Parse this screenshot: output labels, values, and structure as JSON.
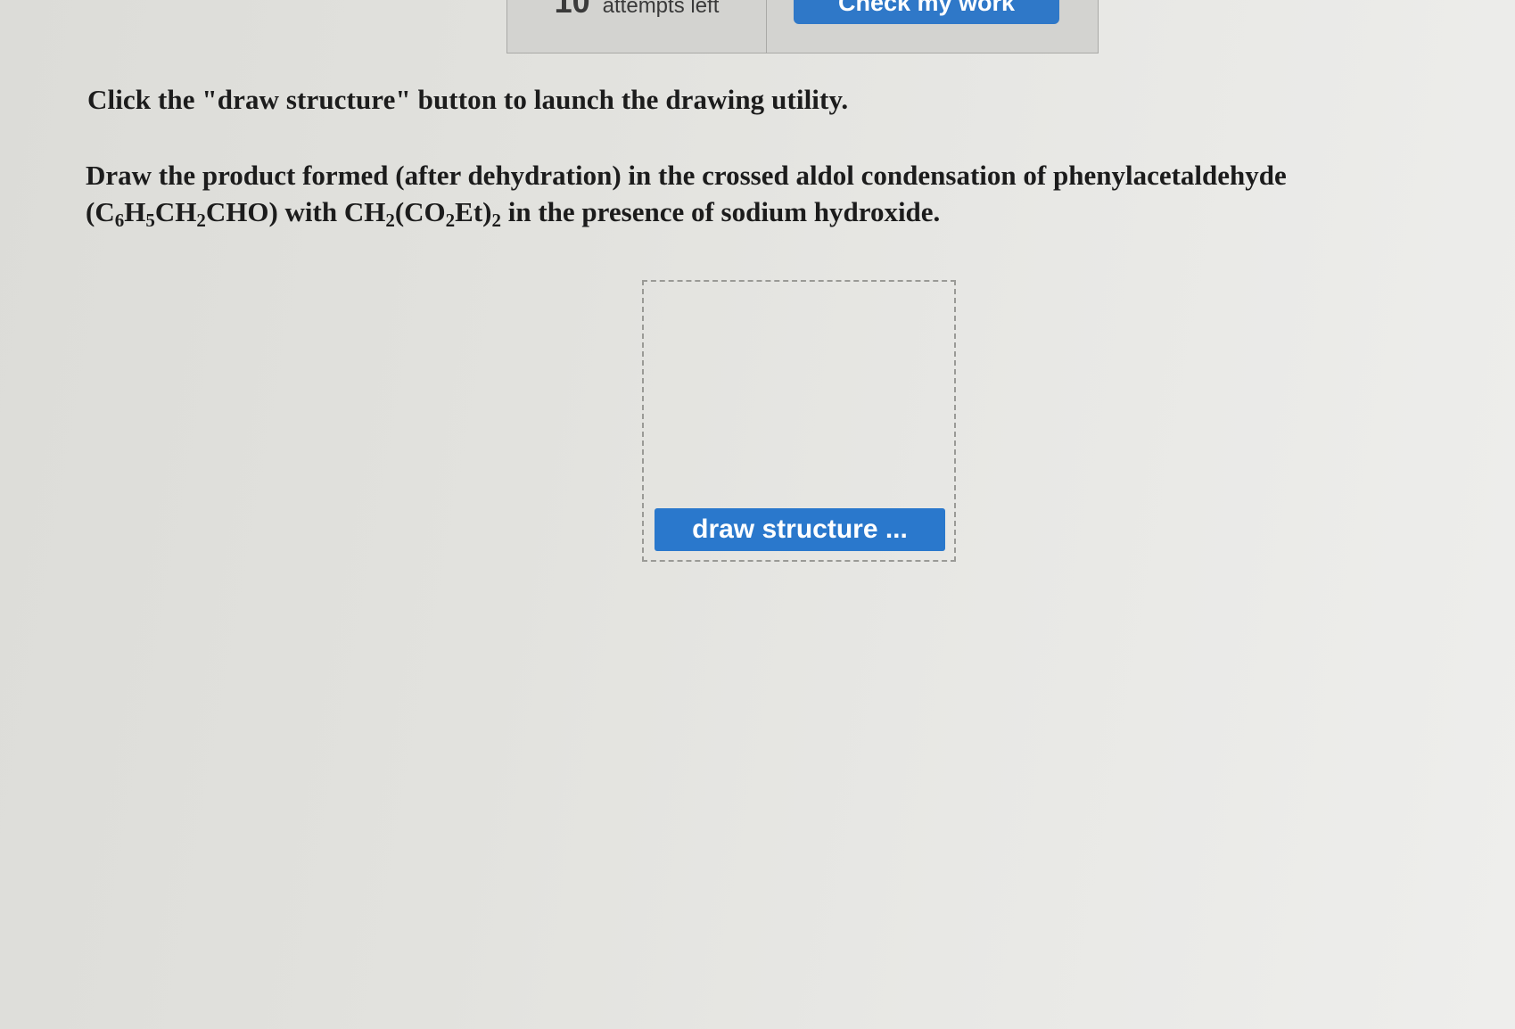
{
  "header": {
    "attempts_count": "10",
    "attempts_label": "attempts left",
    "check_button_label": "Check my work"
  },
  "instruction": "Click the \"draw structure\" button to launch the drawing utility.",
  "question": {
    "line1": "Draw the product formed (after dehydration) in the crossed aldol condensation of phenylacetaldehyde",
    "line2": {
      "p1": "(C",
      "s1": "6",
      "p2": "H",
      "s2": "5",
      "p3": "CH",
      "s3": "2",
      "p4": "CHO) with CH",
      "s4": "2",
      "p5": "(CO",
      "s5": "2",
      "p6": "Et)",
      "s6": "2",
      "p7": " in the presence of sodium hydroxide."
    }
  },
  "drawing_area": {
    "button_label": "draw structure ..."
  }
}
